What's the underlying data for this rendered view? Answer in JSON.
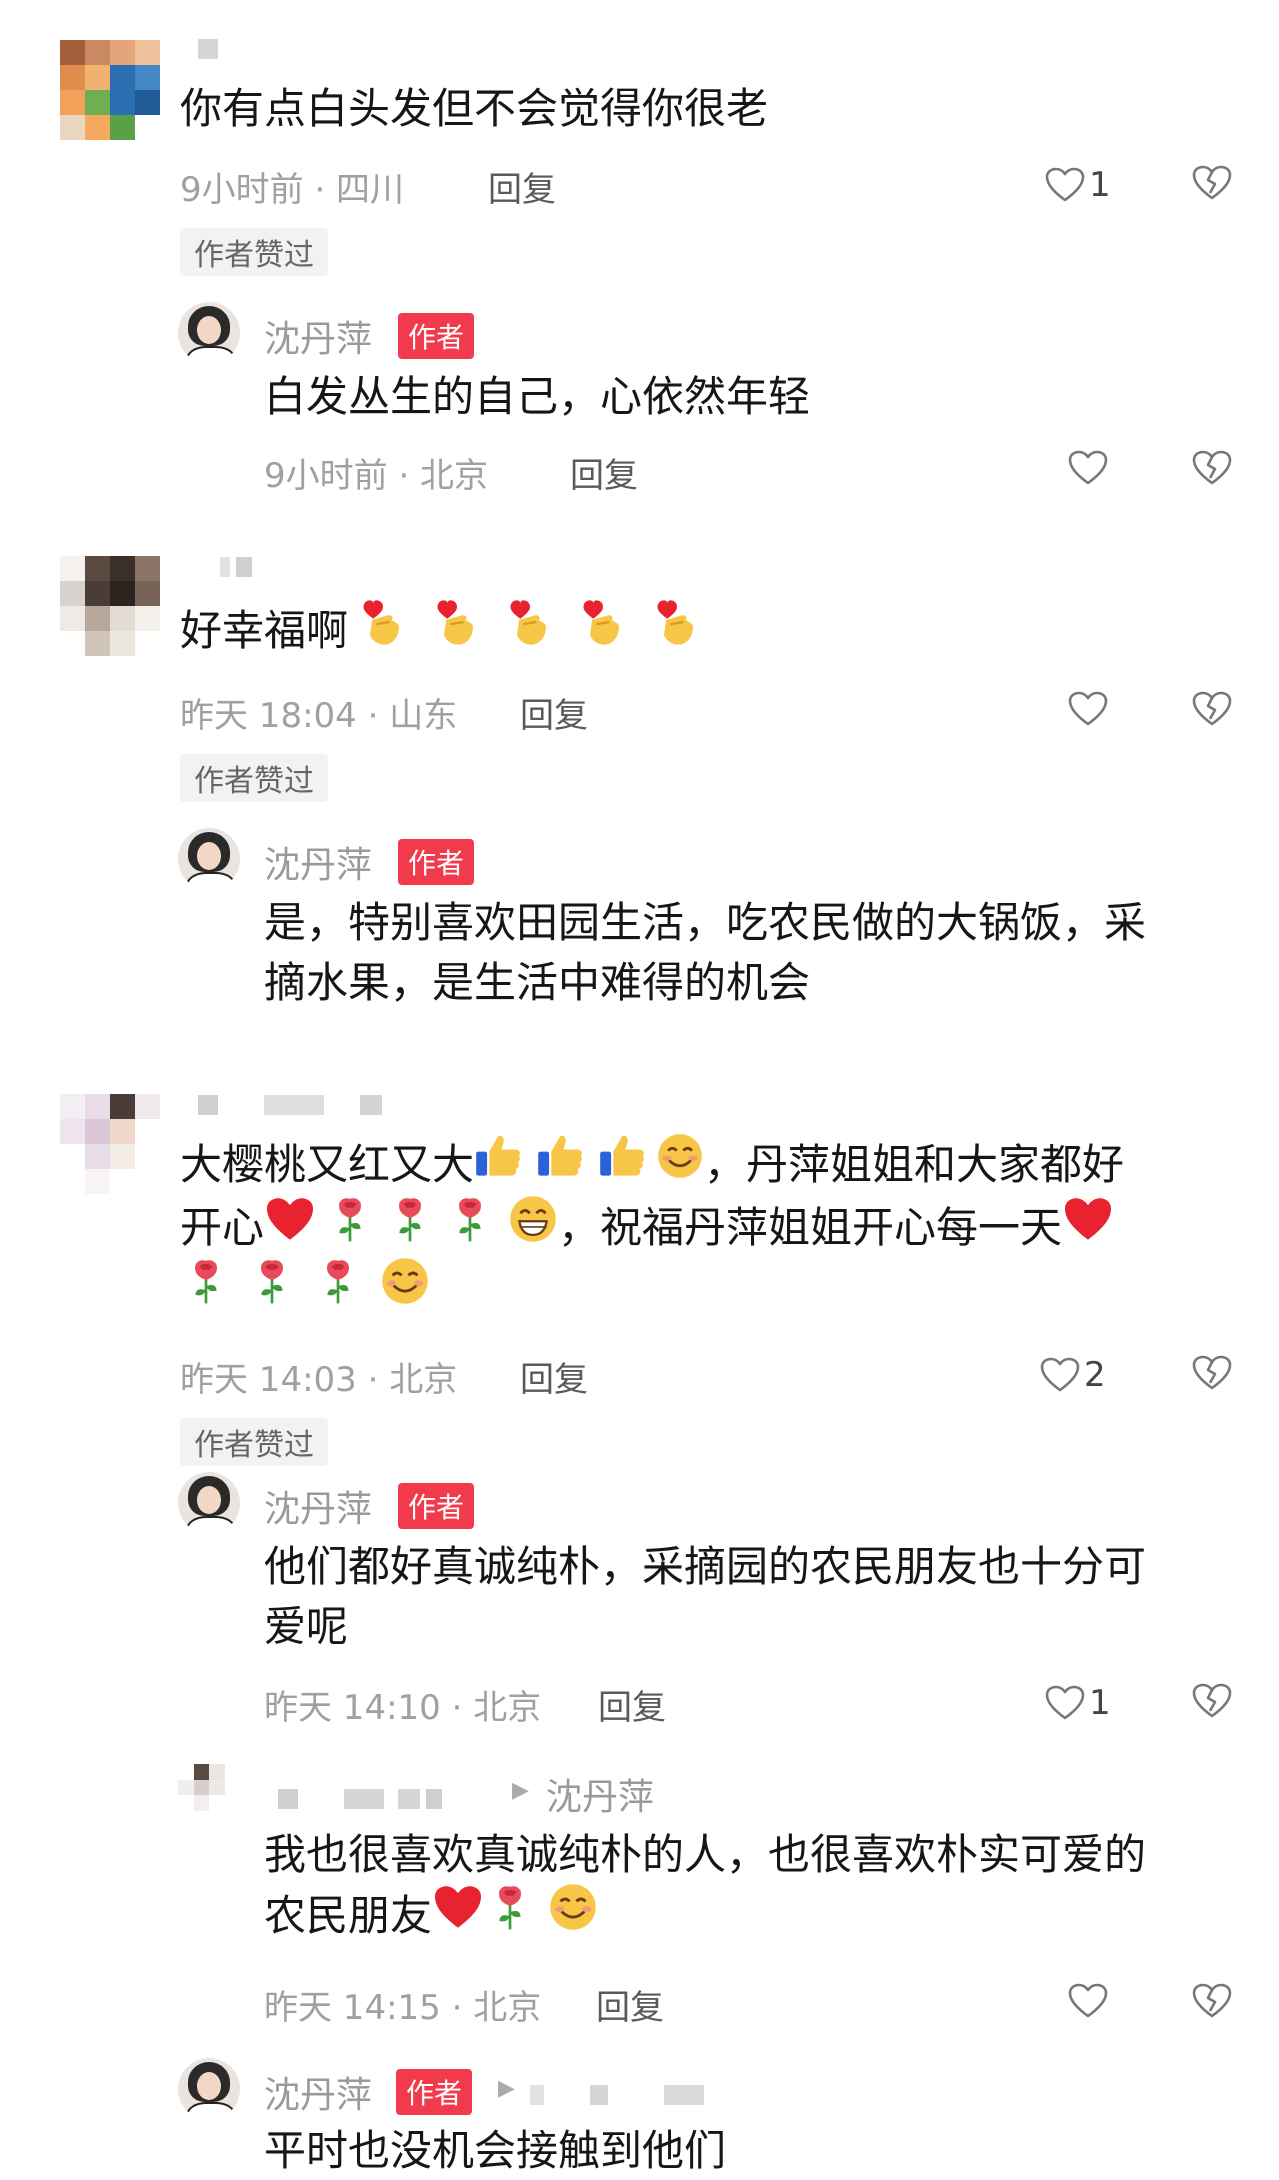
{
  "comments": [
    {
      "text": "你有点白头发但不会觉得你很老",
      "time": "9小时前 · 四川",
      "reply": "回复",
      "likes": "1",
      "liked_badge": "作者赞过",
      "author_reply": {
        "name": "沈丹萍",
        "tag": "作者",
        "text": "白发丛生的自己，心依然年轻",
        "time": "9小时前 · 北京",
        "reply": "回复"
      }
    },
    {
      "text": "好幸福啊",
      "time": "昨天 18:04 · 山东",
      "reply": "回复",
      "liked_badge": "作者赞过",
      "author_reply": {
        "name": "沈丹萍",
        "tag": "作者",
        "text_line1": "是，特别喜欢田园生活，吃农民做的大锅饭，采",
        "text_line2": "摘水果，是生活中难得的机会"
      }
    },
    {
      "text_line1": "大樱桃又红又大",
      "text_line1b": "，丹萍姐姐和大家都好",
      "text_line2a": "开心",
      "text_line2b": "，祝福丹萍姐姐开心每一天",
      "time": "昨天 14:03 · 北京",
      "reply": "回复",
      "likes": "2",
      "liked_badge": "作者赞过",
      "author_reply": {
        "name": "沈丹萍",
        "tag": "作者",
        "text_line1": "他们都好真诚纯朴，采摘园的农民朋友也十分可",
        "text_line2": "爱呢",
        "time": "昨天 14:10 · 北京",
        "reply": "回复",
        "likes": "1"
      },
      "user_reply": {
        "to": "沈丹萍",
        "text_line1": "我也很喜欢真诚纯朴的人，也很喜欢朴实可爱的",
        "text_line2": "农民朋友",
        "time": "昨天 14:15 · 北京",
        "reply": "回复"
      },
      "author_reply2": {
        "name": "沈丹萍",
        "tag": "作者",
        "text": "平时也没机会接触到他们"
      }
    }
  ],
  "colors": {
    "author_tag": "#f23a4d",
    "heart_red": "#e8232f",
    "meta_gray": "#a0a0a0"
  },
  "icons": [
    "heart-outline-icon",
    "broken-heart-icon",
    "finger-heart-emoji",
    "thumbs-up-emoji",
    "smile-emoji",
    "red-heart-emoji",
    "rose-emoji",
    "grin-emoji",
    "play-arrow-icon"
  ]
}
